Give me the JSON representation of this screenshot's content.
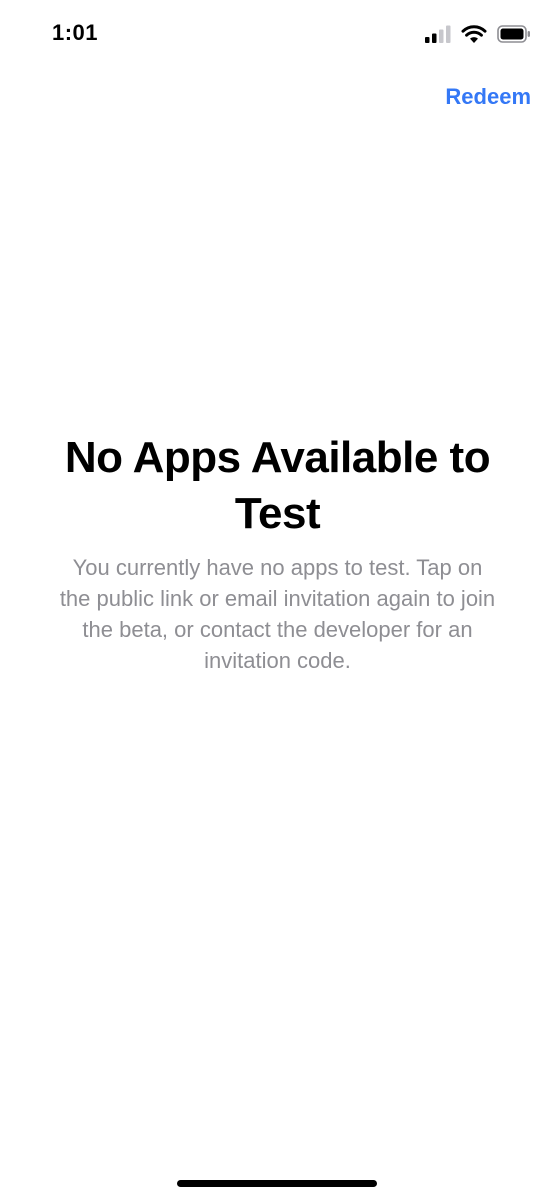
{
  "status_bar": {
    "time": "1:01",
    "icons": [
      "cellular-signal-icon",
      "wifi-icon",
      "battery-icon"
    ]
  },
  "nav": {
    "redeem_label": "Redeem"
  },
  "empty_state": {
    "title": "No Apps Available to Test",
    "message": "You currently have no apps to test. Tap on the public link or email invitation again to join the beta, or contact the developer for an invitation code."
  },
  "colors": {
    "accent": "#3478f6",
    "secondary_text": "#8e8e93"
  }
}
